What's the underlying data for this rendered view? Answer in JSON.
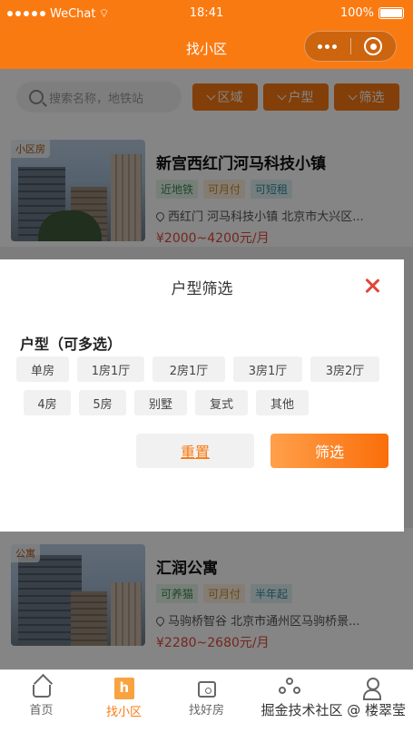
{
  "status_bar": {
    "carrier": "WeChat",
    "time": "18:41",
    "battery": "100%"
  },
  "nav": {
    "title": "找小区"
  },
  "search": {
    "placeholder": "搜索名称，地铁站"
  },
  "filters": [
    {
      "label": "区域"
    },
    {
      "label": "户型"
    },
    {
      "label": "筛选"
    }
  ],
  "listings": [
    {
      "badge": "小区房",
      "title": "新宫西红门河马科技小镇",
      "tags": [
        "近地铁",
        "可月付",
        "可短租"
      ],
      "address": "西红门 河马科技小镇 北京市大兴区...",
      "price": "¥2000~4200元/月"
    },
    {
      "badge": "公寓",
      "title": "汇润公寓",
      "tags": [
        "可养猫",
        "可月付",
        "半年起"
      ],
      "address": "马驹桥智谷 北京市通州区马驹桥景...",
      "price": "¥2280~2680元/月"
    }
  ],
  "filter_sheet": {
    "title": "户型筛选",
    "section_label": "户型（可多选）",
    "options_row1": [
      "单房",
      "1房1厅",
      "2房1厅",
      "3房1厅",
      "3房2厅"
    ],
    "options_row2": [
      "4房",
      "5房",
      "别墅",
      "复式",
      "其他"
    ],
    "reset_label": "重置",
    "confirm_label": "筛选"
  },
  "tab_bar": {
    "tabs": [
      {
        "label": "首页",
        "icon": "home-icon"
      },
      {
        "label": "找小区",
        "icon": "building-icon",
        "active": true
      },
      {
        "label": "找好房",
        "icon": "house-icon"
      },
      {
        "label": "",
        "icon": "community-icon"
      },
      {
        "label": "",
        "icon": "user-icon"
      }
    ]
  },
  "watermark": "掘金技术社区 @ 楼翠莹",
  "colors": {
    "accent": "#fa7a12",
    "price": "#e04a3a",
    "close": "#e0463a"
  }
}
